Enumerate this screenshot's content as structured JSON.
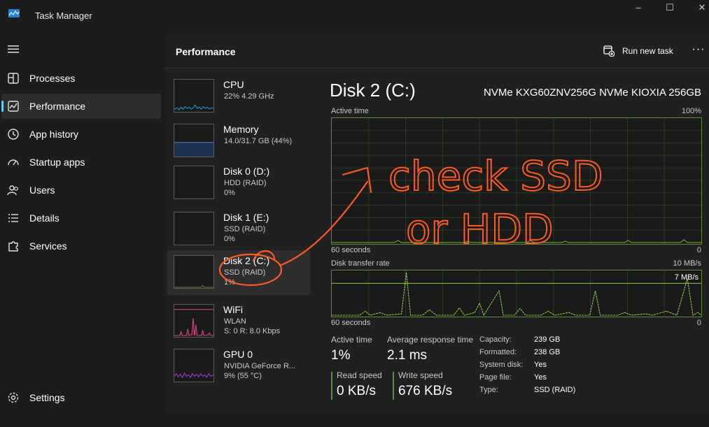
{
  "window": {
    "title": "Task Manager",
    "controls": {
      "minimize": "–",
      "maximize": "☐",
      "close": "✕"
    }
  },
  "sidebar": {
    "items": [
      {
        "label": "Processes",
        "icon": "grid-icon"
      },
      {
        "label": "Performance",
        "icon": "chart-icon",
        "active": true
      },
      {
        "label": "App history",
        "icon": "history-icon"
      },
      {
        "label": "Startup apps",
        "icon": "speedometer-icon"
      },
      {
        "label": "Users",
        "icon": "users-icon"
      },
      {
        "label": "Details",
        "icon": "list-icon"
      },
      {
        "label": "Services",
        "icon": "puzzle-icon"
      }
    ],
    "settings_label": "Settings"
  },
  "header": {
    "title": "Performance",
    "run_task_label": "Run new task",
    "more_label": "···"
  },
  "devices": [
    {
      "name": "CPU",
      "sub1": "22%  4.29 GHz",
      "sub2": "",
      "color": "#17a4d8"
    },
    {
      "name": "Memory",
      "sub1": "14.0/31.7 GB (44%)",
      "sub2": "",
      "color": "#3a6fbf"
    },
    {
      "name": "Disk 0 (D:)",
      "sub1": "HDD (RAID)",
      "sub2": "0%",
      "color": "#5a8a3a"
    },
    {
      "name": "Disk 1 (E:)",
      "sub1": "SSD (RAID)",
      "sub2": "0%",
      "color": "#5a8a3a"
    },
    {
      "name": "Disk 2 (C:)",
      "sub1": "SSD (RAID)",
      "sub2": "1%",
      "color": "#5a8a3a",
      "active": true
    },
    {
      "name": "WiFi",
      "sub1": "WLAN",
      "sub2": "S: 0  R: 8.0 Kbps",
      "color": "#d8488a"
    },
    {
      "name": "GPU 0",
      "sub1": "NVIDIA GeForce R...",
      "sub2": "9%  (55 °C)",
      "color": "#a03fd0"
    }
  ],
  "detail": {
    "title": "Disk 2 (C:)",
    "model": "NVMe KXG60ZNV256G NVMe KIOXIA 256GB",
    "active_graph": {
      "label": "Active time",
      "max": "100%",
      "time_label": "60 seconds",
      "min": "0"
    },
    "transfer_graph": {
      "label": "Disk transfer rate",
      "max": "10 MB/s",
      "line_label": "7 MB/s",
      "time_label": "60 seconds",
      "min": "0"
    },
    "stats": {
      "active_time_label": "Active time",
      "active_time_value": "1%",
      "avg_response_label": "Average response time",
      "avg_response_value": "2.1 ms",
      "read_label": "Read speed",
      "read_value": "0 KB/s",
      "write_label": "Write speed",
      "write_value": "676 KB/s"
    },
    "properties": [
      {
        "label": "Capacity:",
        "value": "239 GB"
      },
      {
        "label": "Formatted:",
        "value": "238 GB"
      },
      {
        "label": "System disk:",
        "value": "Yes"
      },
      {
        "label": "Page file:",
        "value": "Yes"
      },
      {
        "label": "Type:",
        "value": "SSD (RAID)"
      }
    ]
  },
  "annotation": {
    "text_line1": "check SSD",
    "text_line2": "or HDD",
    "color": "#ff5a1f"
  }
}
